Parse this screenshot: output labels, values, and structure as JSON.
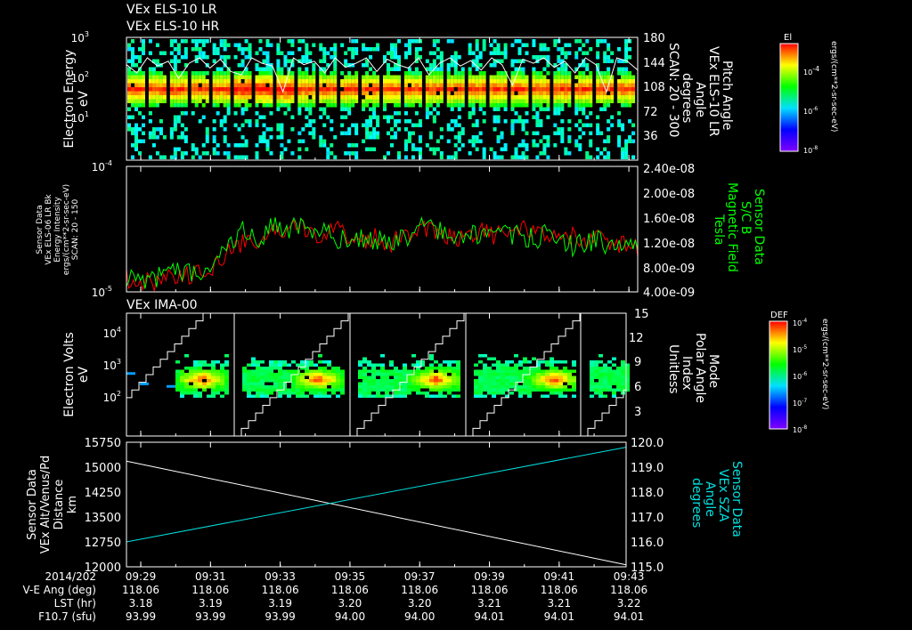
{
  "colors": {
    "background": "#000000",
    "axis": "#ffffff",
    "red": "#ff0000",
    "green": "#00ff00",
    "cyan": "#00e0e0",
    "white": "#ffffff"
  },
  "chart_data": [
    {
      "type": "heatmap",
      "id": "panel1",
      "titles": [
        "VEx ELS-10 LR",
        "VEx ELS-10 HR"
      ],
      "ylabel": [
        "Electron Energy",
        "eV"
      ],
      "yscale": "log",
      "ylim": [
        1,
        1000
      ],
      "yticks": [
        {
          "v": 1000,
          "label": "10",
          "exp": "3"
        },
        {
          "v": 100,
          "label": "10",
          "exp": "2"
        },
        {
          "v": 10,
          "label": "10",
          "exp": "1"
        }
      ],
      "y2label": [
        "Pitch Angle",
        "VEx ELS-10 LR",
        "Angle",
        "degrees",
        "SCAN: 20 - 300"
      ],
      "y2lim": [
        0,
        180
      ],
      "y2ticks": [
        "36",
        "72",
        "108",
        "144",
        "180"
      ],
      "peak_energy_eV": 60,
      "scan_blocks": 24,
      "colorbar": {
        "title": "El",
        "ticks": [
          {
            "label": "10",
            "exp": "-4"
          },
          {
            "label": "10",
            "exp": "-6"
          },
          {
            "label": "10",
            "exp": "-8"
          }
        ],
        "unit": "ergs/(cm**2-sr-sec-eV)"
      },
      "overlay_line": {
        "name": "pitch angle",
        "color": "#ffffff",
        "values_deg": [
          140,
          128,
          150,
          138,
          145,
          120,
          142,
          150,
          135,
          148,
          130,
          125,
          150,
          142,
          138,
          100,
          150,
          140,
          145,
          128,
          150,
          136,
          142,
          150,
          130,
          148,
          140,
          135,
          150,
          125,
          142,
          150,
          138,
          146,
          132,
          150,
          140,
          110,
          148,
          142,
          150,
          136,
          145,
          128,
          150,
          140,
          100,
          150,
          145,
          132
        ]
      }
    },
    {
      "type": "line",
      "id": "panel2",
      "ylabel": [
        "Sensor Data",
        "VEx ELS-06 LR Bk",
        "Energy Intensity",
        "ergs/(cm**2-sr-sec-eV)",
        "SCAN: 20 - 150"
      ],
      "yscale": "log",
      "ylim": [
        1e-05,
        0.0001
      ],
      "yticks": [
        {
          "v": 0.0001,
          "label": "10",
          "exp": "-4"
        },
        {
          "v": 1e-05,
          "label": "10",
          "exp": "-5"
        }
      ],
      "y2label": [
        "Sensor Data",
        "S/C B",
        "Magnetic Field",
        "Tesla"
      ],
      "y2lim": [
        4e-09,
        2.4e-08
      ],
      "y2ticks": [
        "4.00e-09",
        "8.00e-09",
        "1.20e-08",
        "1.60e-08",
        "2.00e-08",
        "2.40e-08"
      ],
      "series": [
        {
          "name": "Energy Intensity",
          "color": "#ff0000",
          "values": [
            1.3e-05,
            1.25e-05,
            1.2e-05,
            1.3e-05,
            1.4e-05,
            1.35e-05,
            1.5e-05,
            1.7e-05,
            2.2e-05,
            2.5e-05,
            2.3e-05,
            3.2e-05,
            2.6e-05,
            3.4e-05,
            3e-05,
            2.9e-05,
            3.3e-05,
            2.7e-05,
            2.6e-05,
            2.8e-05,
            2.4e-05,
            2.9e-05,
            3.1e-05,
            3.3e-05,
            3e-05,
            2.7e-05,
            2.9e-05,
            3.2e-05,
            2.8e-05,
            3e-05,
            3.3e-05,
            2.9e-05,
            3.1e-05,
            2.6e-05,
            2.8e-05,
            2.5e-05,
            2.7e-05,
            2.3e-05,
            2.5e-05,
            2.2e-05
          ]
        },
        {
          "name": "Magnetic Field",
          "color": "#00ff00",
          "values": [
            1.35e-05,
            1.3e-05,
            1.25e-05,
            1.4e-05,
            1.5e-05,
            1.4e-05,
            1.6e-05,
            1.9e-05,
            2.4e-05,
            3.3e-05,
            2.4e-05,
            3.6e-05,
            2.8e-05,
            3.5e-05,
            2.9e-05,
            3e-05,
            2.7e-05,
            2.5e-05,
            2.8e-05,
            2.6e-05,
            2.5e-05,
            2.7e-05,
            3e-05,
            3.6e-05,
            3e-05,
            2.6e-05,
            2.8e-05,
            3e-05,
            2.7e-05,
            2.9e-05,
            2.8e-05,
            2.7e-05,
            2.9e-05,
            2.6e-05,
            2.4e-05,
            2.5e-05,
            2.6e-05,
            2.2e-05,
            2.4e-05,
            2.3e-05
          ]
        }
      ]
    },
    {
      "type": "heatmap",
      "id": "panel3",
      "title": "VEx IMA-00",
      "ylabel": [
        "Electron Volts",
        "eV"
      ],
      "yscale": "log",
      "ylim": [
        10,
        40000
      ],
      "yticks": [
        {
          "v": 10000,
          "label": "10",
          "exp": "4"
        },
        {
          "v": 1000,
          "label": "10",
          "exp": "3"
        },
        {
          "v": 100,
          "label": "10",
          "exp": "2"
        }
      ],
      "y2label": [
        "Mode",
        "Polar Angle",
        "Index",
        "Unitless"
      ],
      "y2lim": [
        0,
        15
      ],
      "y2ticks": [
        "3",
        "6",
        "9",
        "12",
        "15"
      ],
      "peak_energy_eV": 500,
      "peak_times": [
        "09:30:40",
        "09:33:30",
        "09:37:00",
        "09:40:20"
      ],
      "mode_resets": [
        "09:32:00",
        "09:35:20",
        "09:38:40",
        "09:42:00"
      ],
      "colorbar": {
        "title": "DEF",
        "ticks": [
          {
            "label": "10",
            "exp": "-4"
          },
          {
            "label": "10",
            "exp": "-5"
          },
          {
            "label": "10",
            "exp": "-6"
          },
          {
            "label": "10",
            "exp": "-7"
          },
          {
            "label": "10",
            "exp": "-8"
          }
        ],
        "unit": "ergs/(cm**2-sr-sec-eV)"
      }
    },
    {
      "type": "line",
      "id": "panel4",
      "ylabel": [
        "Sensor Data",
        "VEx Alt/Venus/Pd",
        "Distance",
        "km"
      ],
      "ylim": [
        12000,
        15750
      ],
      "yticks": [
        "12000",
        "12750",
        "13500",
        "14250",
        "15000",
        "15750"
      ],
      "y2label": [
        "Sensor Data",
        "VEx SZA",
        "Angle",
        "degrees"
      ],
      "y2lim": [
        115.0,
        120.0
      ],
      "y2ticks": [
        "115.0",
        "116.0",
        "117.0",
        "118.0",
        "119.0",
        "120.0"
      ],
      "series": [
        {
          "name": "Distance",
          "color": "#ffffff",
          "start": 15180,
          "end": 12060
        },
        {
          "name": "SZA",
          "color": "#00e0e0",
          "start": 116.0,
          "end": 119.8
        }
      ]
    }
  ],
  "time_axis": {
    "row_labels": [
      "2014/202",
      "V-E Ang (deg)",
      "LST (hr)",
      "F10.7 (sfu)"
    ],
    "ticks": [
      "09:29",
      "09:31",
      "09:33",
      "09:35",
      "09:37",
      "09:39",
      "09:41",
      "09:43"
    ],
    "v_e_ang": [
      "118.06",
      "118.06",
      "118.06",
      "118.06",
      "118.06",
      "118.06",
      "118.06",
      "118.06"
    ],
    "lst": [
      "3.18",
      "3.19",
      "3.19",
      "3.20",
      "3.20",
      "3.21",
      "3.21",
      "3.22"
    ],
    "f107": [
      "93.99",
      "93.99",
      "93.99",
      "94.00",
      "94.00",
      "94.01",
      "94.01",
      "94.01"
    ]
  }
}
